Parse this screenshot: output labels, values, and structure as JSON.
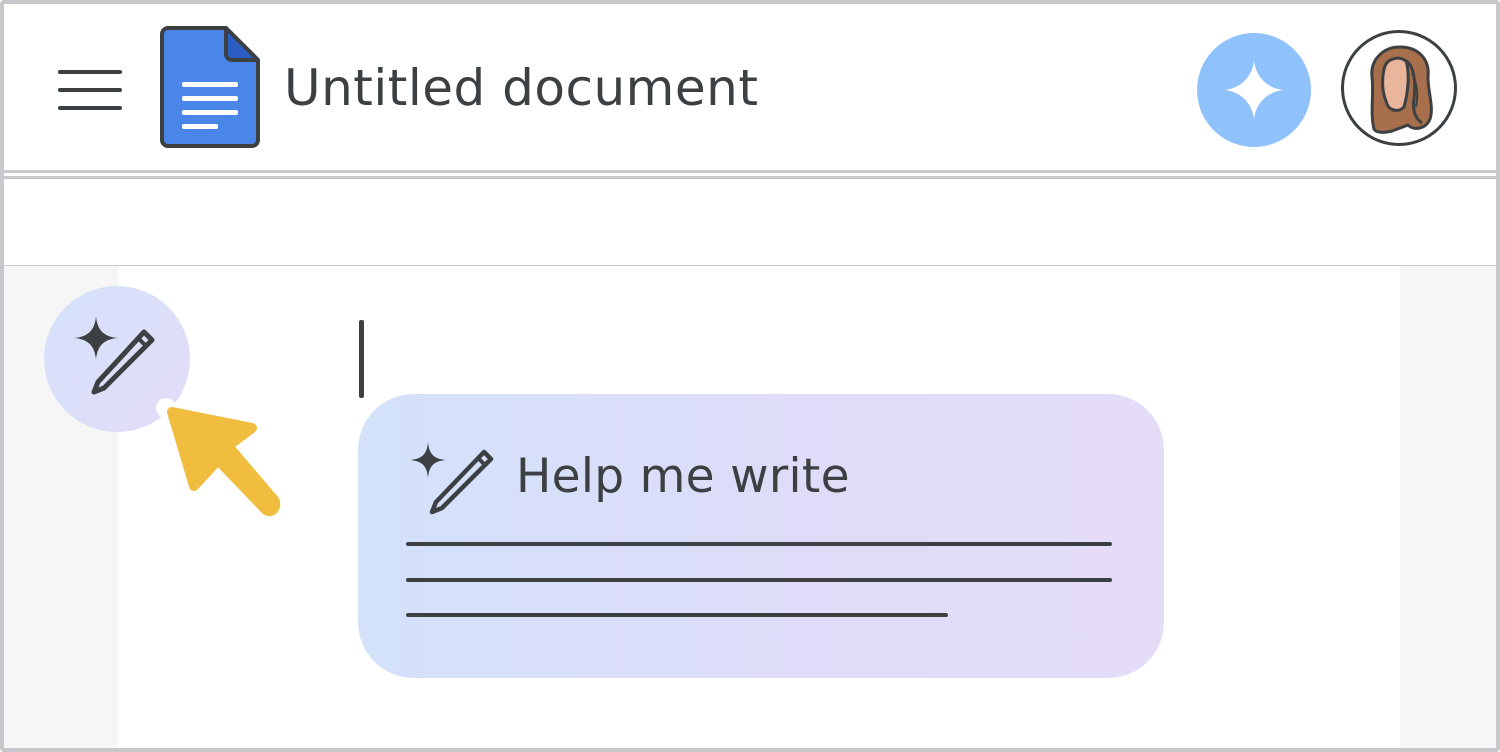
{
  "header": {
    "title": "Untitled document",
    "menu_icon": "hamburger-menu-icon",
    "app_icon": "google-docs-icon",
    "gemini_icon": "gemini-sparkle-icon",
    "avatar_icon": "user-avatar"
  },
  "editor": {
    "fab_icon": "sparkle-pencil-icon",
    "help_me_write": {
      "label": "Help me write",
      "icon": "sparkle-pencil-icon"
    }
  },
  "colors": {
    "gemini_button": "#8fc2fb",
    "docs_blue": "#4a86e8",
    "pointer_yellow": "#f0bd3e",
    "card_gradient_start": "#d3e1fa",
    "card_gradient_end": "#e5dcf8"
  }
}
